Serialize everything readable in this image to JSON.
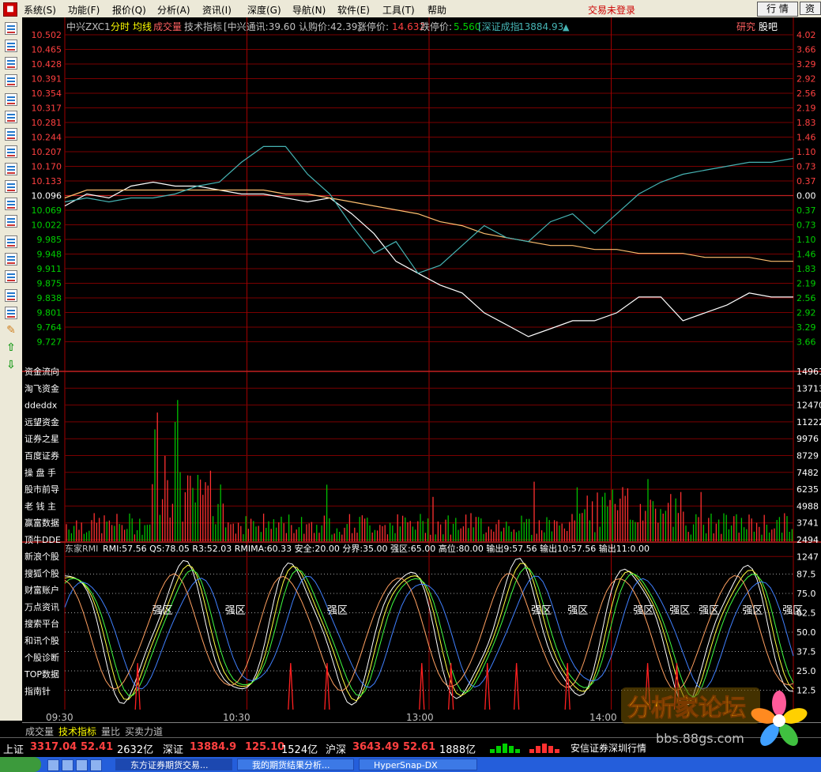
{
  "menu": {
    "items": [
      "系统(S)",
      "功能(F)",
      "报价(Q)",
      "分析(A)",
      "资讯(I)",
      "深度(G)",
      "导航(N)",
      "软件(E)",
      "工具(T)",
      "帮助"
    ],
    "login_status": "交易未登录",
    "quote_button": "行 情",
    "info_button": "资"
  },
  "header": {
    "stock_name": "中兴ZXC1",
    "mode": "分时",
    "avg_line": "均线",
    "volume": "成交量",
    "tech": "技术指标",
    "news": "[中兴通讯:39.60",
    "subscribe": "认购价:42.39]",
    "limit_up_label": "涨停价:",
    "limit_up": "14.632",
    "limit_down_label": "跌停价:",
    "limit_down": "5.560",
    "index_label": "[深证成指",
    "index_value": "13884.93",
    "research": "研究",
    "forum": "股吧"
  },
  "price_axis": {
    "left": [
      "10.502",
      "10.465",
      "10.428",
      "10.391",
      "10.354",
      "10.317",
      "10.281",
      "10.244",
      "10.207",
      "10.170",
      "10.133",
      "10.096",
      "10.069",
      "10.022",
      "9.985",
      "9.948",
      "9.911",
      "9.875",
      "9.838",
      "9.801",
      "9.764",
      "9.727"
    ],
    "right": [
      "4.02",
      "3.66",
      "3.29",
      "2.92",
      "2.56",
      "2.19",
      "1.83",
      "1.46",
      "1.10",
      "0.73",
      "0.37",
      "0.00",
      "0.37",
      "0.73",
      "1.10",
      "1.46",
      "1.83",
      "2.19",
      "2.56",
      "2.92",
      "3.29",
      "3.66"
    ]
  },
  "volume_panel": {
    "right_labels": [
      "14961",
      "13713",
      "12470",
      "11222",
      "9976",
      "8729",
      "7482",
      "6235",
      "4988",
      "3741",
      "2494",
      "1247"
    ],
    "side_labels": [
      "资金流向",
      "淘飞资金",
      "ddeddx",
      "远望资金",
      "证券之星",
      "百度证券",
      "操 盘 手",
      "股市前导",
      "老 钱 主",
      "赢富数据",
      "顶牛DDE"
    ]
  },
  "indicator": {
    "title": "东家RMI",
    "params": [
      {
        "label": "RMI:",
        "value": "57.56"
      },
      {
        "label": "QS:",
        "value": "78.05"
      },
      {
        "label": "R3:",
        "value": "52.03"
      },
      {
        "label": "RMIMA:",
        "value": "60.33"
      },
      {
        "label": "安全:",
        "value": "20.00"
      },
      {
        "label": "分界:",
        "value": "35.00"
      },
      {
        "label": "强区:",
        "value": "65.00"
      },
      {
        "label": "高位:",
        "value": "80.00"
      },
      {
        "label": "输出",
        "value": "9:57.56"
      },
      {
        "label": "输出",
        "value": "10:57.56"
      },
      {
        "label": "输出",
        "value": "11:0.00"
      }
    ],
    "right_labels": [
      "87.5",
      "75.0",
      "62.5",
      "50.0",
      "37.5",
      "25.0",
      "12.5"
    ],
    "zone_label": "强区",
    "side_labels": [
      "新浪个股",
      "搜狐个股",
      "财富账户",
      "万点资讯",
      "搜索平台",
      "和讯个股",
      "个股诊断",
      "TOP数据",
      "指南针"
    ]
  },
  "time_axis": [
    "09:30",
    "10:30",
    "13:00",
    "14:00"
  ],
  "tabs": [
    "成交量",
    "技术指标",
    "量比",
    "买卖力道"
  ],
  "ticker": {
    "sh_label": "上证",
    "sh_value": "3317.04",
    "sh_change": "52.41",
    "sh_amount": "2632亿",
    "sz_label": "深证",
    "sz_value": "13884.9",
    "sz_change": "125.10",
    "sz_amount": "1524亿",
    "hs_label": "沪深",
    "hs_value": "3643.49",
    "hs_change": "52.61",
    "hs_amount": "1888亿",
    "broker": "安信证券深圳行情"
  },
  "taskbar": {
    "items": [
      "东方证券期货交易...",
      "我的期货结果分析...",
      "HyperSnap-DX"
    ]
  },
  "watermark": {
    "title": "分析家论坛",
    "url": "bbs.88gs.com"
  },
  "colors": {
    "up": "#ff3c3c",
    "down": "#00d000",
    "grid": "#7a0000",
    "price_line": "#ffffff",
    "avg_line": "#ffc070",
    "index_line": "#46b4b4",
    "accent_yellow": "#ffff00"
  },
  "chart_data": {
    "type": "line",
    "series": [
      {
        "name": "分时",
        "values": [
          10.07,
          10.1,
          10.09,
          10.12,
          10.13,
          10.12,
          10.12,
          10.11,
          10.1,
          10.1,
          10.09,
          10.08,
          10.09,
          10.05,
          10.0,
          9.93,
          9.9,
          9.87,
          9.85,
          9.8,
          9.77,
          9.74,
          9.76,
          9.78,
          9.78,
          9.8,
          9.84,
          9.84,
          9.78,
          9.8,
          9.82,
          9.85,
          9.84,
          9.84
        ]
      },
      {
        "name": "均线",
        "values": [
          10.09,
          10.11,
          10.11,
          10.11,
          10.11,
          10.11,
          10.11,
          10.11,
          10.11,
          10.11,
          10.1,
          10.1,
          10.09,
          10.08,
          10.07,
          10.06,
          10.05,
          10.03,
          10.02,
          10.0,
          9.99,
          9.98,
          9.97,
          9.97,
          9.96,
          9.96,
          9.95,
          9.95,
          9.95,
          9.94,
          9.94,
          9.94,
          9.93,
          9.93
        ]
      },
      {
        "name": "指数",
        "values": [
          10.08,
          10.09,
          10.08,
          10.09,
          10.09,
          10.1,
          10.12,
          10.13,
          10.18,
          10.22,
          10.22,
          10.15,
          10.1,
          10.02,
          9.95,
          9.98,
          9.9,
          9.92,
          9.97,
          10.02,
          9.99,
          9.98,
          10.03,
          10.05,
          10.0,
          10.05,
          10.1,
          10.13,
          10.15,
          10.16,
          10.17,
          10.18,
          10.18,
          10.19
        ]
      }
    ],
    "ylim": [
      9.727,
      10.502
    ]
  }
}
